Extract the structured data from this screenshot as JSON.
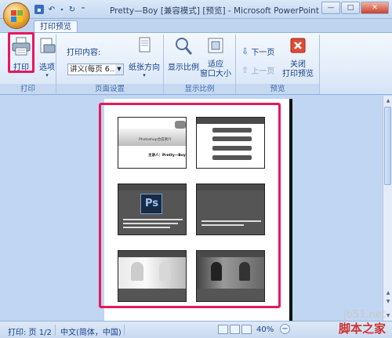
{
  "window": {
    "title": "Pretty—Boy [兼容模式] [预览] - Microsoft PowerPoint",
    "controls": [
      "—",
      "□",
      "✕"
    ]
  },
  "tab": {
    "label": "打印预览"
  },
  "ribbon": {
    "print_label": "打印",
    "options_label": "选项",
    "print_what_label": "打印内容:",
    "print_what_value": "讲义(每页 6...",
    "orientation_label": "纸张方向",
    "zoom_label": "显示比例",
    "fit_label": "适应\n窗口大小",
    "next_page_label": "下一页",
    "prev_page_label": "上一页",
    "close_label": "关闭\n打印预览",
    "groups": {
      "print": "打印",
      "page_setup": "页面设置",
      "zoom": "显示比例",
      "preview": "预览"
    }
  },
  "slides": {
    "s1_title": "Photoshop合成简介",
    "s1_sub": "主讲人：Pretty—Boy",
    "s3_logo": "Ps"
  },
  "status": {
    "page": "打印: 页 1/2",
    "language": "中文(简体，中国)",
    "zoom": "40%"
  },
  "watermark": {
    "site": "jb51.net",
    "name": "脚本之家"
  },
  "colors": {
    "highlight": "#e8175d",
    "ribbon_text": "#15428b"
  }
}
